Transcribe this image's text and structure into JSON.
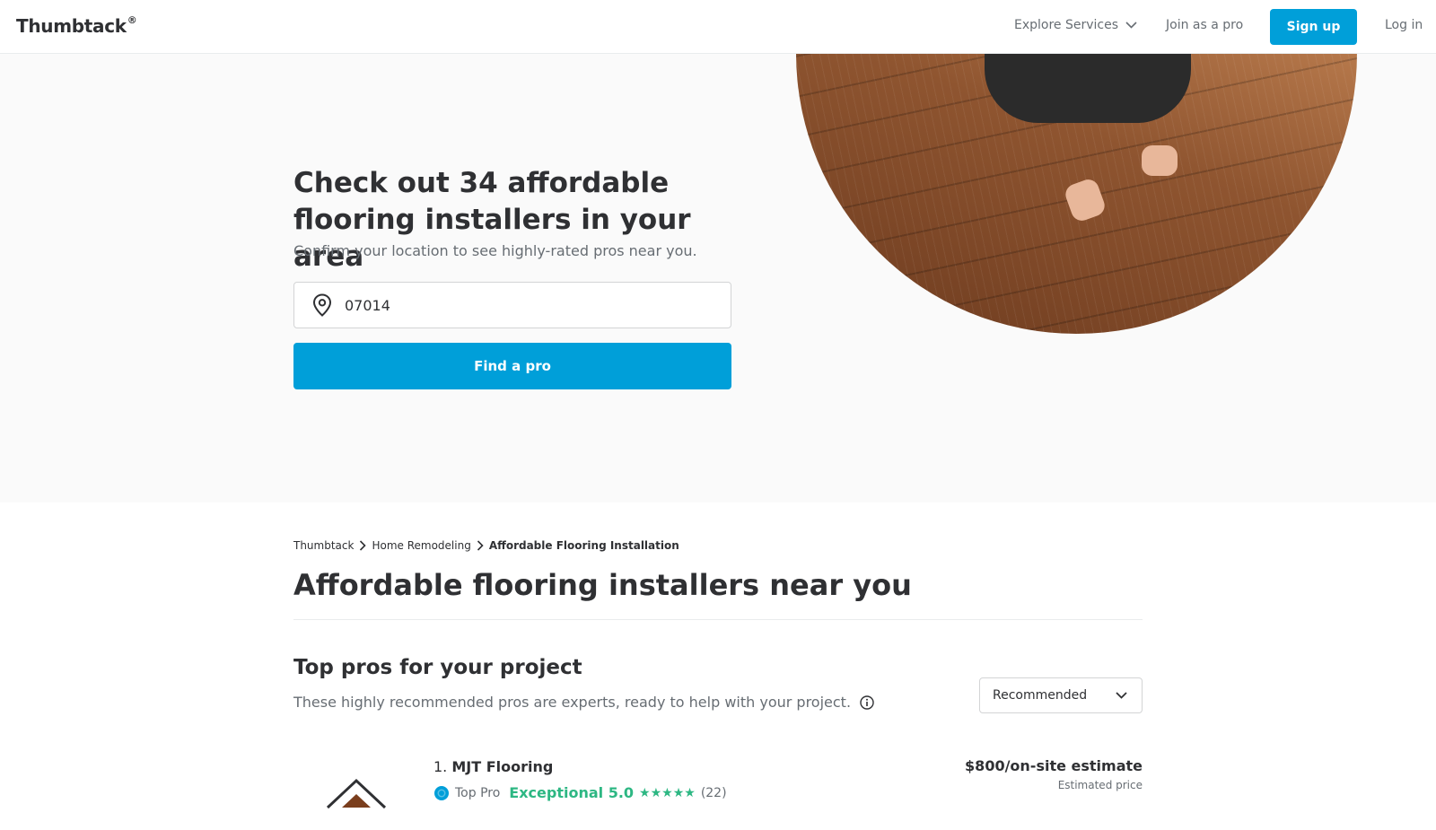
{
  "header": {
    "logo": "Thumbtack",
    "logo_mark": "®",
    "explore": "Explore Services",
    "join": "Join as a pro",
    "signup": "Sign up",
    "login": "Log in"
  },
  "hero": {
    "title": "Check out 34 affordable flooring installers in your area",
    "subtitle": "Confirm your location to see highly-rated pros near you.",
    "zip_value": "07014",
    "find_button": "Find a pro"
  },
  "breadcrumb": {
    "items": [
      "Thumbtack",
      "Home Remodeling",
      "Affordable Flooring Installation"
    ]
  },
  "page_title": "Affordable flooring installers near you",
  "section": {
    "title": "Top pros for your project",
    "subtitle": "These highly recommended pros are experts, ready to help with your project.",
    "sort_value": "Recommended"
  },
  "pros": [
    {
      "rank": "1.",
      "name": "MJT Flooring",
      "badge": "Top Pro",
      "rating_label": "Exceptional 5.0",
      "stars": "★★★★★",
      "reviews": "(22)",
      "price": "$800/on-site estimate",
      "price_note": "Estimated price"
    }
  ],
  "colors": {
    "accent": "#009fd9",
    "rating": "#2db783",
    "text": "#2f3033",
    "muted": "#676d73",
    "hero_bg": "#fafafa"
  },
  "icons": [
    "chevron-down-icon",
    "location-pin-icon",
    "chevron-right-icon",
    "info-icon",
    "top-pro-badge-icon",
    "star-icon"
  ]
}
